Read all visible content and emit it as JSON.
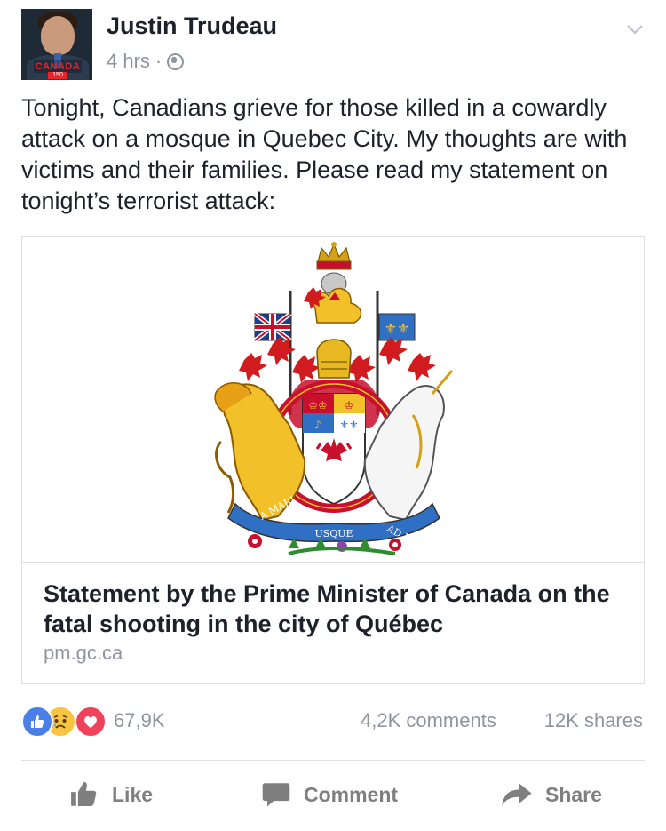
{
  "post": {
    "author": "Justin Trudeau",
    "time": "4 hrs",
    "separator": "·",
    "avatar_badge": "CANADA",
    "avatar_badge_sub": "150",
    "text": "Tonight, Canadians grieve for those killed in a cowardly attack on a mosque in Quebec City. My thoughts are with victims and their families. Please read my statement on tonight’s terrorist attack:",
    "icons": {
      "privacy": "globe-icon",
      "options": "chevron-down-icon"
    }
  },
  "link": {
    "title": "Statement by the Prime Minister of Canada on the fatal shooting in the city of Québec",
    "domain": "pm.gc.ca",
    "image": "coat-of-arms-of-canada",
    "motto_left": "A MARI",
    "motto_center": "USQUE",
    "motto_right": "AD MARE"
  },
  "engagement": {
    "reaction_count": "67,9K",
    "comments": "4,2K comments",
    "shares": "12K shares",
    "reaction_icons": [
      "like-icon",
      "sad-icon",
      "love-icon"
    ],
    "colors": {
      "like": "#4a7fe8",
      "sad": "#f7c53f",
      "love": "#f0435b"
    }
  },
  "actions": {
    "like": "Like",
    "comment": "Comment",
    "share": "Share"
  }
}
